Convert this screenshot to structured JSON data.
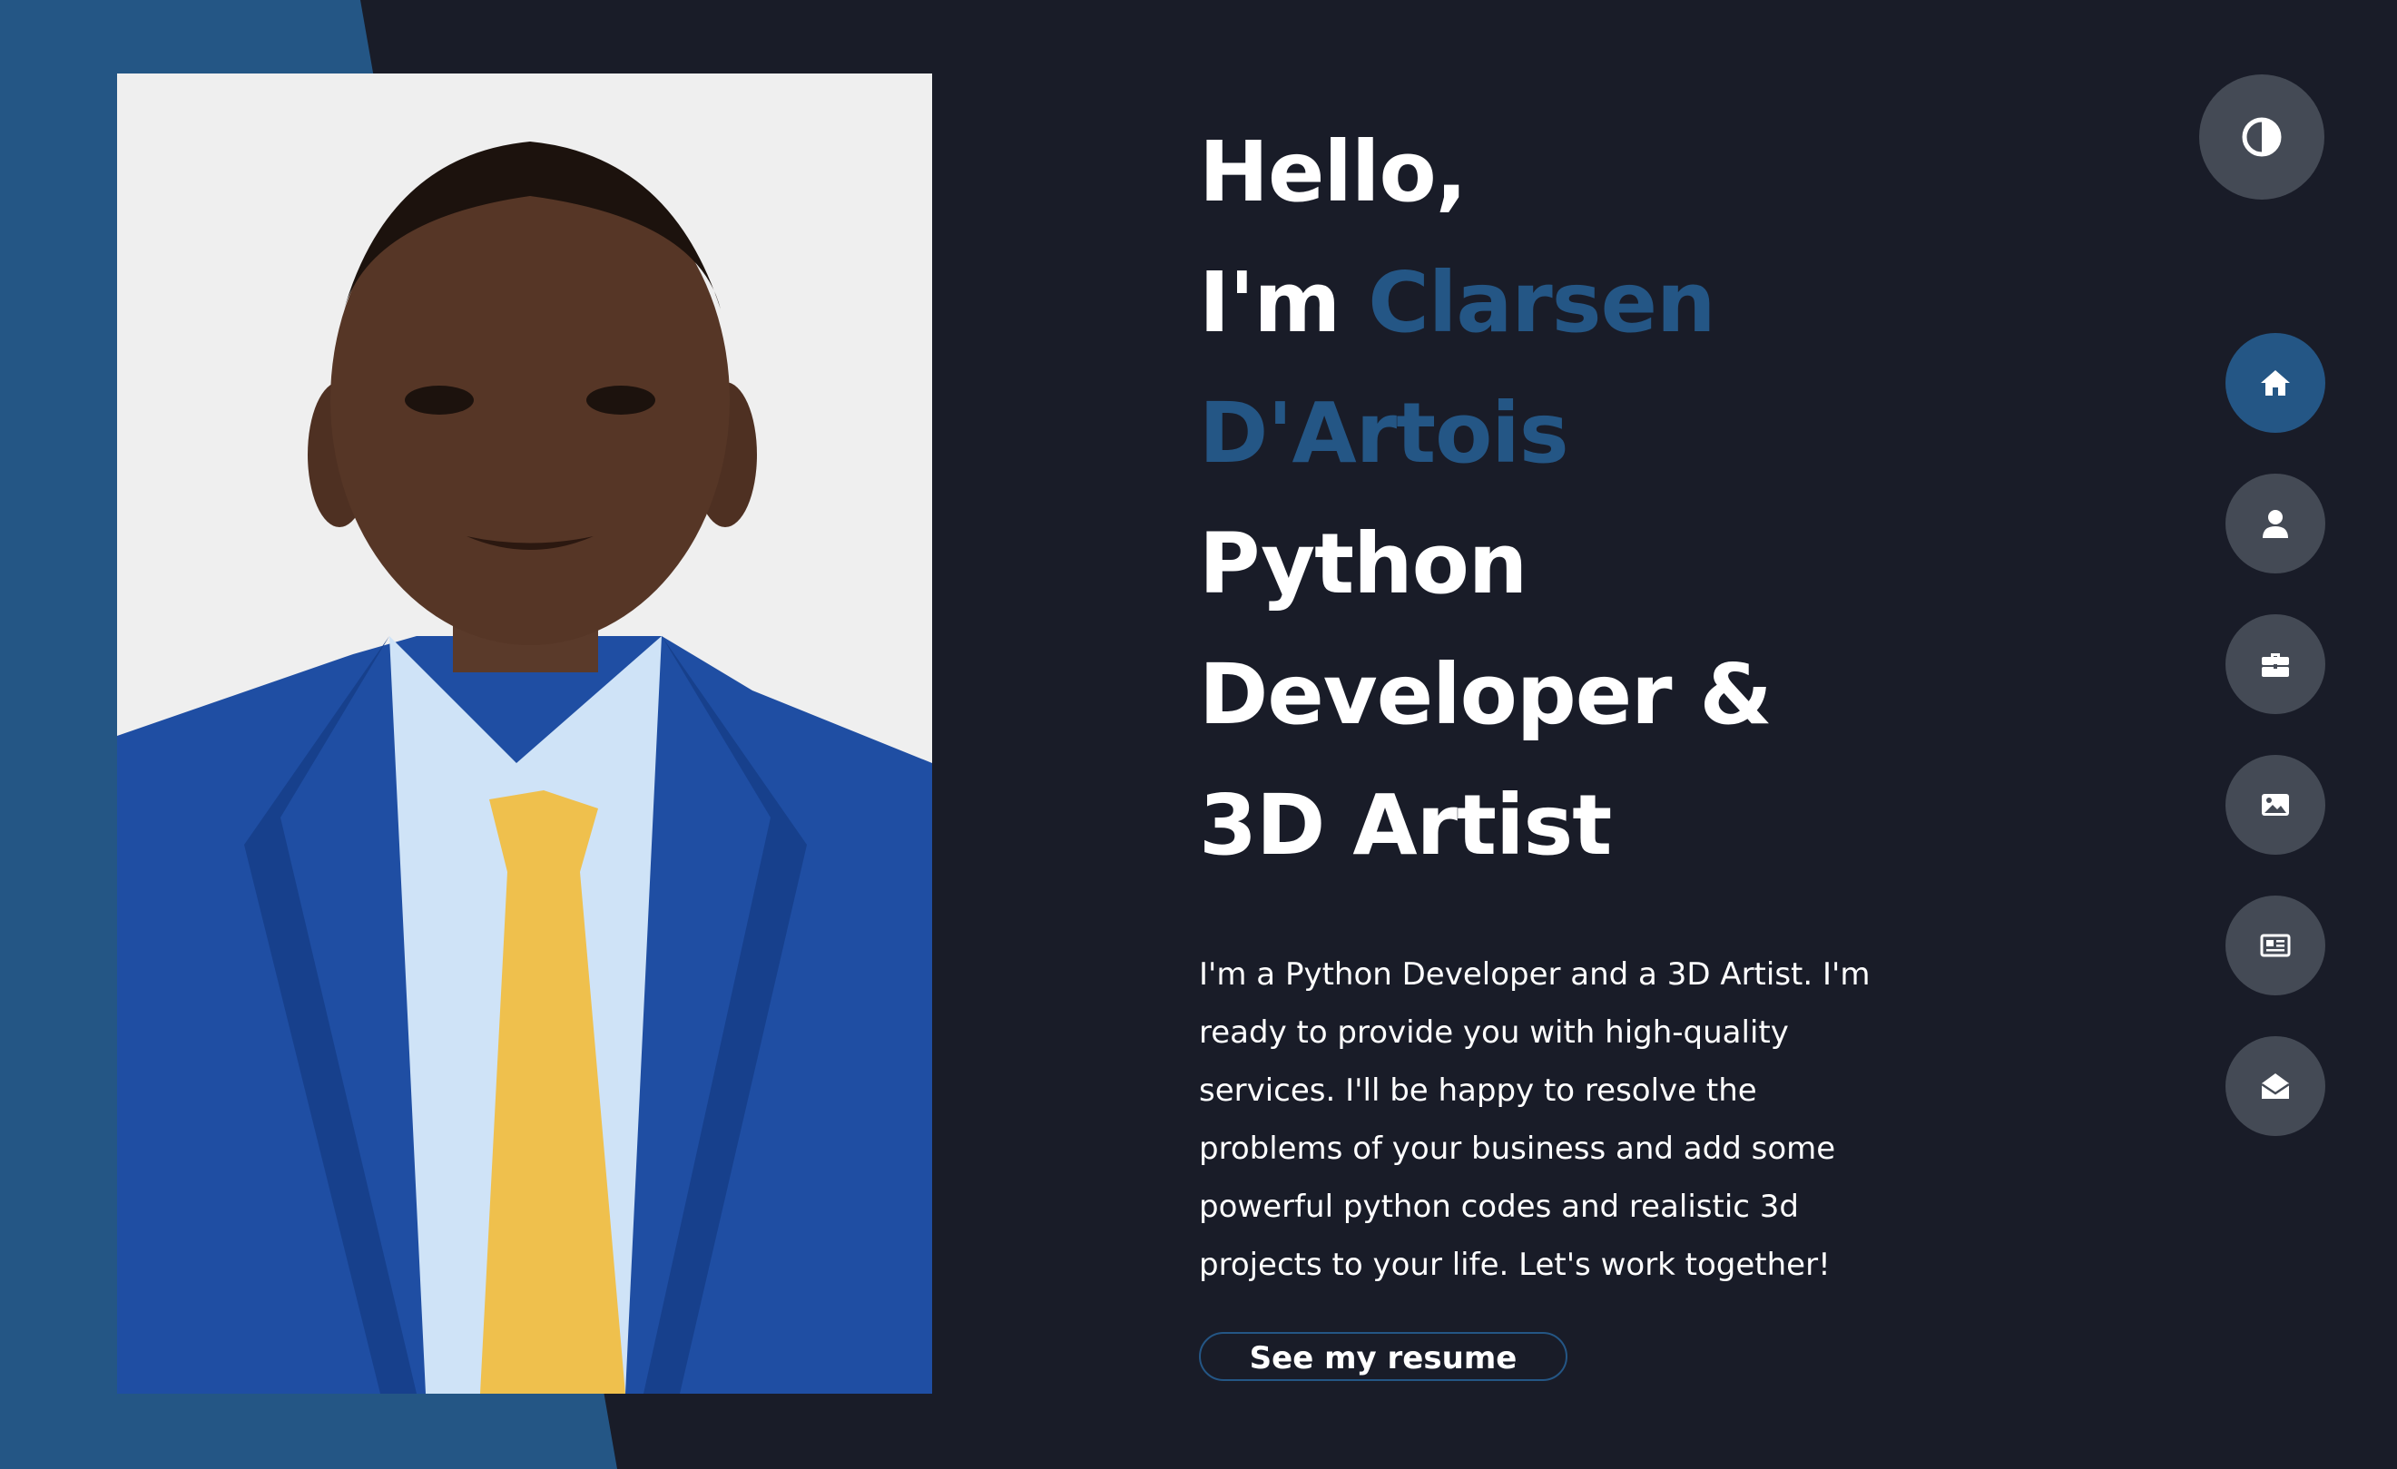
{
  "hero": {
    "greeting": "Hello,",
    "intro_prefix": "I'm ",
    "name_first": "Clarsen",
    "name_last": "D'Artois",
    "title_line1": "Python",
    "title_line2": "Developer &",
    "title_line3": "3D Artist",
    "bio_line1": "I'm a Python Developer and a 3D Artist. I'm",
    "bio_line2": "ready to provide you with high-quality",
    "bio_line3": "services. I'll be happy to resolve the",
    "bio_line4": "problems of your business and add some",
    "bio_line5": "powerful python codes and realistic 3d",
    "bio_line6": "projects to your life. Let's work together!",
    "resume_button": "See my resume"
  },
  "theme_toggle": {
    "icon": "contrast-icon"
  },
  "nav": [
    {
      "icon": "home-icon",
      "active": true
    },
    {
      "icon": "user-icon",
      "active": false
    },
    {
      "icon": "briefcase-icon",
      "active": false
    },
    {
      "icon": "image-icon",
      "active": false
    },
    {
      "icon": "newspaper-icon",
      "active": false
    },
    {
      "icon": "envelope-open-icon",
      "active": false
    }
  ],
  "colors": {
    "background": "#191c28",
    "accent": "#245685",
    "button_gray": "#444a55",
    "text": "#ffffff"
  }
}
